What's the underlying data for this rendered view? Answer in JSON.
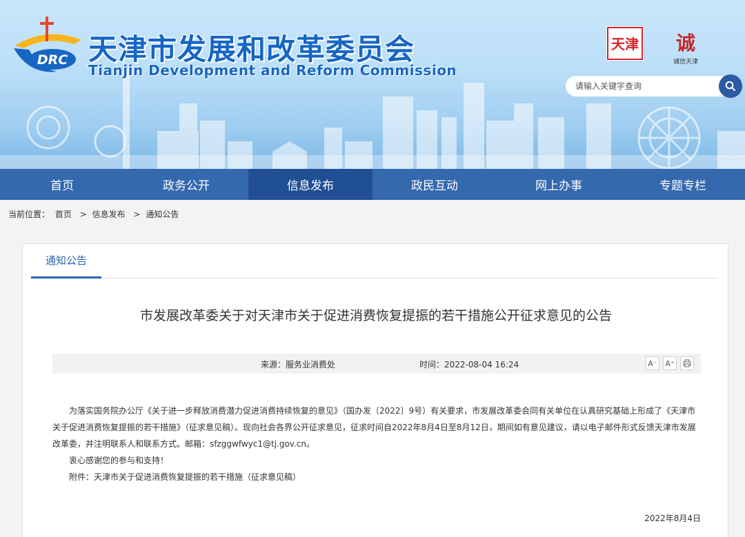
{
  "header": {
    "title_cn": "天津市发展和改革委员会",
    "title_en": "Tianjin Development and Reform Commission",
    "logo_text": "DRC",
    "badge_red_text": "天津",
    "badge_credit_text": "诚信天津",
    "search_placeholder": "请输入关键字查询"
  },
  "nav": {
    "items": [
      {
        "label": "首页"
      },
      {
        "label": "政务公开"
      },
      {
        "label": "信息发布"
      },
      {
        "label": "政民互动"
      },
      {
        "label": "网上办事"
      },
      {
        "label": "专题专栏"
      }
    ],
    "active_index": 2
  },
  "breadcrumb": {
    "prefix": "当前位置：",
    "items": [
      "首页",
      "信息发布",
      "通知公告"
    ],
    "separator": ">"
  },
  "article": {
    "tab": "通知公告",
    "title": "市发展改革委关于对天津市关于促进消费恢复提振的若干措施公开征求意见的公告",
    "source": "来源：服务业消费处",
    "time": "时间：2022-08-04 16:24",
    "tools": {
      "font_decrease": "A⁻",
      "font_increase": "A⁺"
    },
    "paragraphs": [
      "为落实国务院办公厅《关于进一步释放消费潜力促进消费持续恢复的意见》（国办发〔2022〕9号）有关要求，市发展改革委会同有关单位在认真研究基础上形成了《天津市关于促进消费恢复提振的若干措施》（征求意见稿）。现向社会各界公开征求意见，征求时间自2022年8月4日至8月12日，期间如有意见建议，请以电子邮件形式反馈天津市发展改革委，并注明联系人和联系方式。邮箱：sfzggwfwyc1@tj.gov.cn。",
      "衷心感谢您的参与和支持！",
      "附件：天津市关于促进消费恢复提振的若干措施（征求意见稿）"
    ],
    "date": "2022年8月4日"
  },
  "colors": {
    "brand_blue": "#1666c4",
    "nav_bg": "#3569ad",
    "nav_active": "#204f94",
    "tab_accent": "#2b63b0"
  }
}
